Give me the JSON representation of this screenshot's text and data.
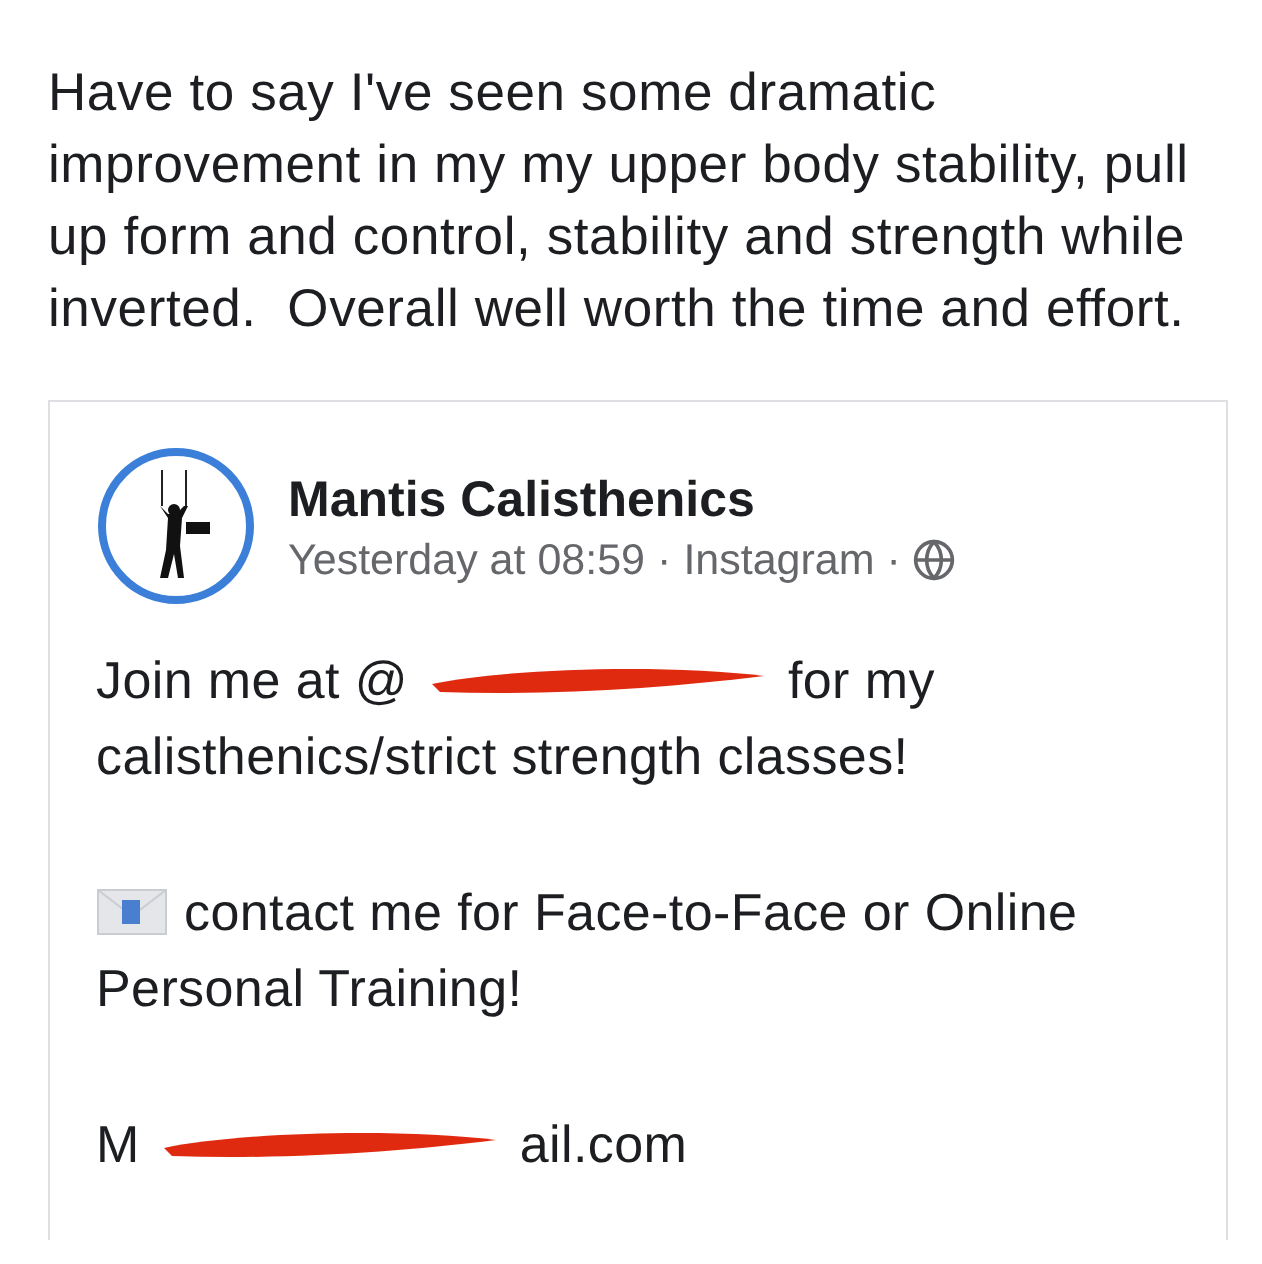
{
  "comment": {
    "text": "Have to say I've seen some dramatic improvement in my my upper body stability, pull up form and control, stability and strength while inverted.  Overall well worth the time and effort."
  },
  "shared_post": {
    "author": "Mantis Calisthenics",
    "time": "Yesterday at 08:59",
    "separator": "·",
    "source": "Instagram",
    "paragraphs": [
      {
        "lines": [
          [
            {
              "kind": "text",
              "text": "Join me at @"
            },
            {
              "kind": "redaction"
            },
            {
              "kind": "text",
              "text": "for my"
            }
          ],
          [
            {
              "kind": "text",
              "text": "calisthenics/strict strength classes!"
            }
          ]
        ]
      },
      {
        "lines": [
          [
            {
              "kind": "envelope"
            },
            {
              "kind": "text",
              "text": "contact me for Face-to-Face or Online"
            }
          ],
          [
            {
              "kind": "text",
              "text": "Personal Training!"
            }
          ]
        ]
      },
      {
        "lines": [
          [
            {
              "kind": "text",
              "text": "M"
            },
            {
              "kind": "redaction"
            },
            {
              "kind": "text",
              "text": "ail.com"
            }
          ]
        ]
      }
    ]
  }
}
